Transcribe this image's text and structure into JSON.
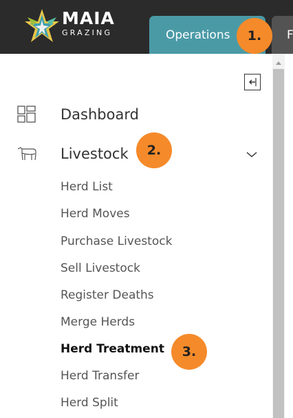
{
  "header": {
    "brand_name": "MAIA",
    "brand_sub": "GRAZING",
    "tabs": [
      {
        "label": "Operations",
        "active": true
      },
      {
        "label": "F",
        "active": false
      }
    ]
  },
  "sidebar": {
    "collapse_icon": "collapse-left-icon",
    "items": [
      {
        "label": "Dashboard",
        "icon": "dashboard-icon"
      },
      {
        "label": "Livestock",
        "icon": "cow-icon",
        "expanded": true,
        "subitems": [
          "Herd List",
          "Herd Moves",
          "Purchase Livestock",
          "Sell Livestock",
          "Register Deaths",
          "Merge Herds",
          "Herd Treatment",
          "Herd Transfer",
          "Herd Split"
        ],
        "active_subitem": "Herd Treatment"
      }
    ]
  },
  "annotations": [
    "1.",
    "2.",
    "3."
  ],
  "colors": {
    "topbar": "#2b2b2b",
    "active_tab": "#4a9aa6",
    "badge": "#f58a2a"
  }
}
